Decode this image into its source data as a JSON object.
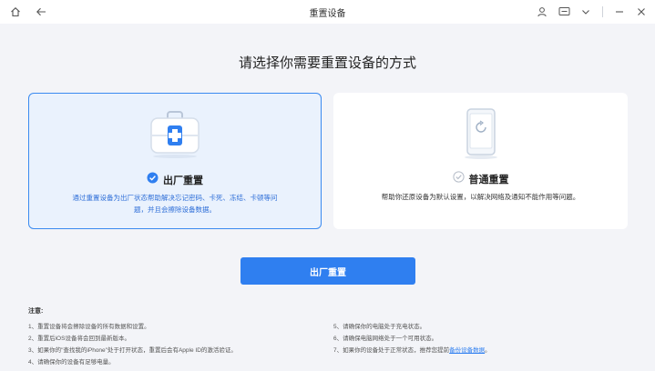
{
  "window": {
    "title": "重置设备"
  },
  "main": {
    "heading": "请选择你需要重置设备的方式"
  },
  "options": [
    {
      "label": "出厂重置",
      "description_line1": "通过重置设备为出厂状态帮助解决忘记密码、卡死、冻结、卡顿等问",
      "description_line2": "题，并且会擦除设备数据。",
      "selected": true
    },
    {
      "label": "普通重置",
      "description_line1": "帮助你还原设备为默认设置，以解决网络及通知不能作用等问题。",
      "selected": false
    }
  ],
  "action": {
    "button_label": "出厂重置"
  },
  "notes": {
    "title": "注意:",
    "left": [
      "1、重置设备将会擦除设备的所有数据和设置。",
      "2、重置后iOS设备将会回到最新版本。",
      "3、如果你的\"查找我的iPhone\"处于打开状态，重置后会有Apple ID的激活验证。",
      "4、请确保你的设备有足够电量。"
    ],
    "right": [
      "5、请确保你的电脑处于充电状态。",
      "6、请确保电脑网络处于一个可用状态。"
    ],
    "right_7_prefix": "7、如果你的设备处于正常状态，推荐您提前",
    "right_7_link": "备份设备数据",
    "right_7_suffix": "。"
  },
  "colors": {
    "accent": "#2f7ff0",
    "selected_bg": "#eaf2fd",
    "page_bg": "#f3f4f8"
  }
}
